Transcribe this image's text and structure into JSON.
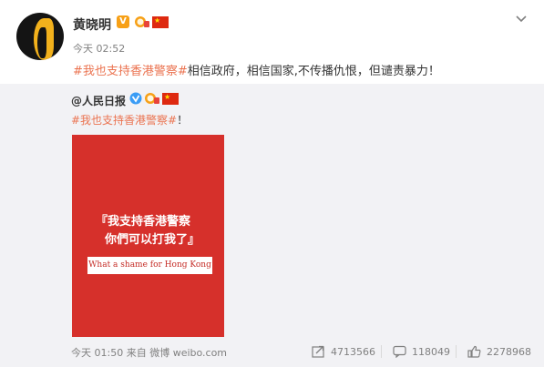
{
  "post": {
    "username": "黄晓明",
    "time": "今天 02:52",
    "hashtag": "#我也支持香港警察#",
    "text": "相信政府，相信国家,不传播仇恨，但谴责暴力！"
  },
  "repost": {
    "author": "@人民日报",
    "hashtag": "#我也支持香港警察#",
    "text": "！",
    "poster": {
      "quote_open": "『",
      "line1": "我支持香港警察",
      "line2": "你們可以打我了",
      "quote_close": "』",
      "banner": "What a shame for Hong Kong"
    },
    "footer": {
      "time": "今天 01:50",
      "source": "来自 微博 weibo.com"
    },
    "stats": {
      "reposts": "4713566",
      "comments": "118049",
      "likes": "2278968"
    }
  },
  "colors": {
    "hashtag": "#eb7350",
    "poster_red": "#d6302b",
    "meta_gray": "#808080",
    "badge_orange": "#f7a016"
  },
  "icons": [
    "verified-v-icon",
    "member-badge-icon",
    "china-flag-icon",
    "chevron-down-icon",
    "blue-verified-icon",
    "repost-icon",
    "comment-icon",
    "like-icon"
  ]
}
